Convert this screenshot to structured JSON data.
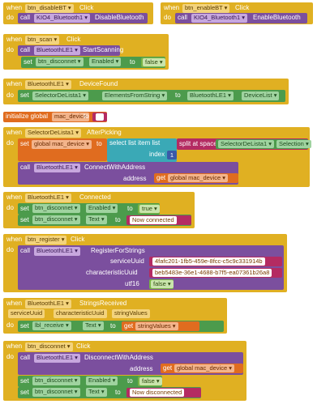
{
  "k": {
    "when": "when",
    "do": "do",
    "call": "call",
    "set": "set",
    "to": "to",
    "get": "get",
    "index": "index",
    "initialize_global": "initialize global"
  },
  "blocks": {
    "disable": {
      "component": "btn_disableBT",
      "event": "Click",
      "call_target": "KIO4_Bluetooth1",
      "call_method": "DisableBluetooth"
    },
    "enable": {
      "component": "btn_enableBT",
      "event": "Click",
      "call_target": "KIO4_Bluetooth1",
      "call_method": "EnableBluetooth"
    },
    "scan": {
      "component": "btn_scan",
      "event": "Click",
      "call_target": "BluetoothLE1",
      "call_method": "StartScanning",
      "set_component": "btn_disconnet",
      "set_prop": "Enabled",
      "value": "false"
    },
    "device_found": {
      "component": "BluetoothLE1",
      "event": "DeviceFound",
      "set_component": "SelectorDeLista1",
      "set_prop": "ElementsFromString",
      "get_component": "BluetoothLE1",
      "get_prop": "DeviceList"
    },
    "init": {
      "var": "mac_device",
      "value": ""
    },
    "after_picking": {
      "component": "SelectorDeLista1",
      "event": "AfterPicking",
      "set_var": "global mac_device",
      "select_list_item": "select list item  list",
      "split": "split at spaces",
      "sel_component": "SelectorDeLista1",
      "sel_prop": "Selection",
      "index": "1",
      "call_target": "BluetoothLE1",
      "call_method": "ConnectWithAddress",
      "arg": "address",
      "get_var": "global mac_device"
    },
    "connected": {
      "component": "BluetoothLE1",
      "event": "Connected",
      "set1_component": "btn_disconnet",
      "set1_prop": "Enabled",
      "set1_value": "true",
      "set2_component": "btn_disconnet",
      "set2_prop": "Text",
      "set2_value": "Now connected"
    },
    "register": {
      "component": "btn_register",
      "event": "Click",
      "call_target": "BluetoothLE1",
      "call_method": "RegisterForStrings",
      "arg1": "serviceUuid",
      "val1": "4fafc201-1fb5-459e-8fcc-c5c9c331914b",
      "arg2": "characteristicUuid",
      "val2": "beb5483e-36e1-4688-b7f5-ea07361b26a8",
      "arg3": "utf16",
      "val3": "false"
    },
    "strings_received": {
      "component": "BluetoothLE1",
      "event": "StringsReceived",
      "p1": "serviceUuid",
      "p2": "characteristicUuid",
      "p3": "stringValues",
      "set_component": "lbl_receive",
      "set_prop": "Text",
      "get_var": "stringValues"
    },
    "disconnect": {
      "component": "btn_disconnet",
      "event": "Click",
      "call_target": "BluetoothLE1",
      "call_method": "DisconnectWithAddress",
      "arg": "address",
      "get_var": "global mac_device",
      "set1_component": "btn_disconnet",
      "set1_prop": "Enabled",
      "set1_value": "false",
      "set2_component": "btn_disconnet",
      "set2_prop": "Text",
      "set2_value": "Now disconnected"
    }
  }
}
